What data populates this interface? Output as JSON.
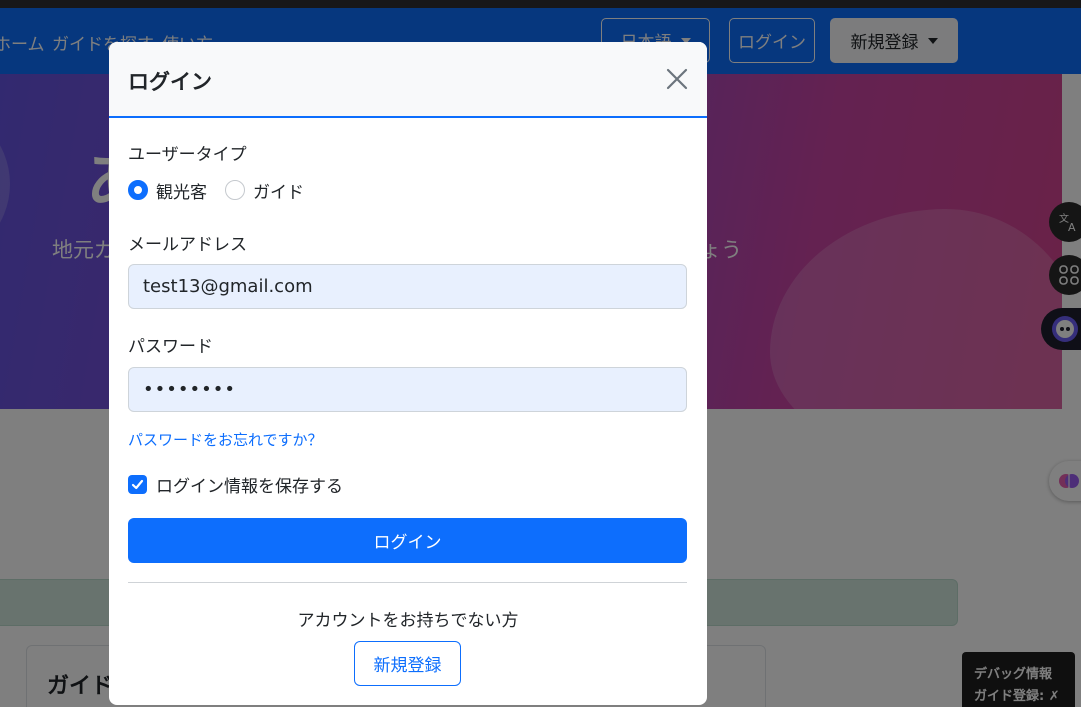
{
  "navbar": {
    "home": "ホーム",
    "find_guide": "ガイドを探す",
    "how_to_use": "使い方",
    "language": "日本語",
    "login": "ログイン",
    "signup": "新規登録"
  },
  "hero": {
    "title_visible": "あ",
    "subtitle_left": "地元ガ",
    "subtitle_right": "ょう"
  },
  "guide_card": {
    "title_visible": "ガイドを"
  },
  "debug": {
    "title": "デバッグ情報",
    "line": "ガイド登録: ✗"
  },
  "modal": {
    "title": "ログイン",
    "user_type": {
      "label": "ユーザータイプ",
      "options": [
        {
          "label": "観光客",
          "selected": true
        },
        {
          "label": "ガイド",
          "selected": false
        }
      ]
    },
    "email": {
      "label": "メールアドレス",
      "value": "test13@gmail.com"
    },
    "password": {
      "label": "パスワード",
      "value": "••••••••"
    },
    "forgot_password": "パスワードをお忘れですか？",
    "remember_me": {
      "label": "ログイン情報を保存する",
      "checked": true
    },
    "submit": "ログイン",
    "no_account_text": "アカウントをお持ちでない方",
    "signup": "新規登録"
  },
  "colors": {
    "primary": "#0d6efd",
    "overlay": "rgba(0,0,0,0.5)",
    "autofill_bg": "#e8f0fe"
  }
}
